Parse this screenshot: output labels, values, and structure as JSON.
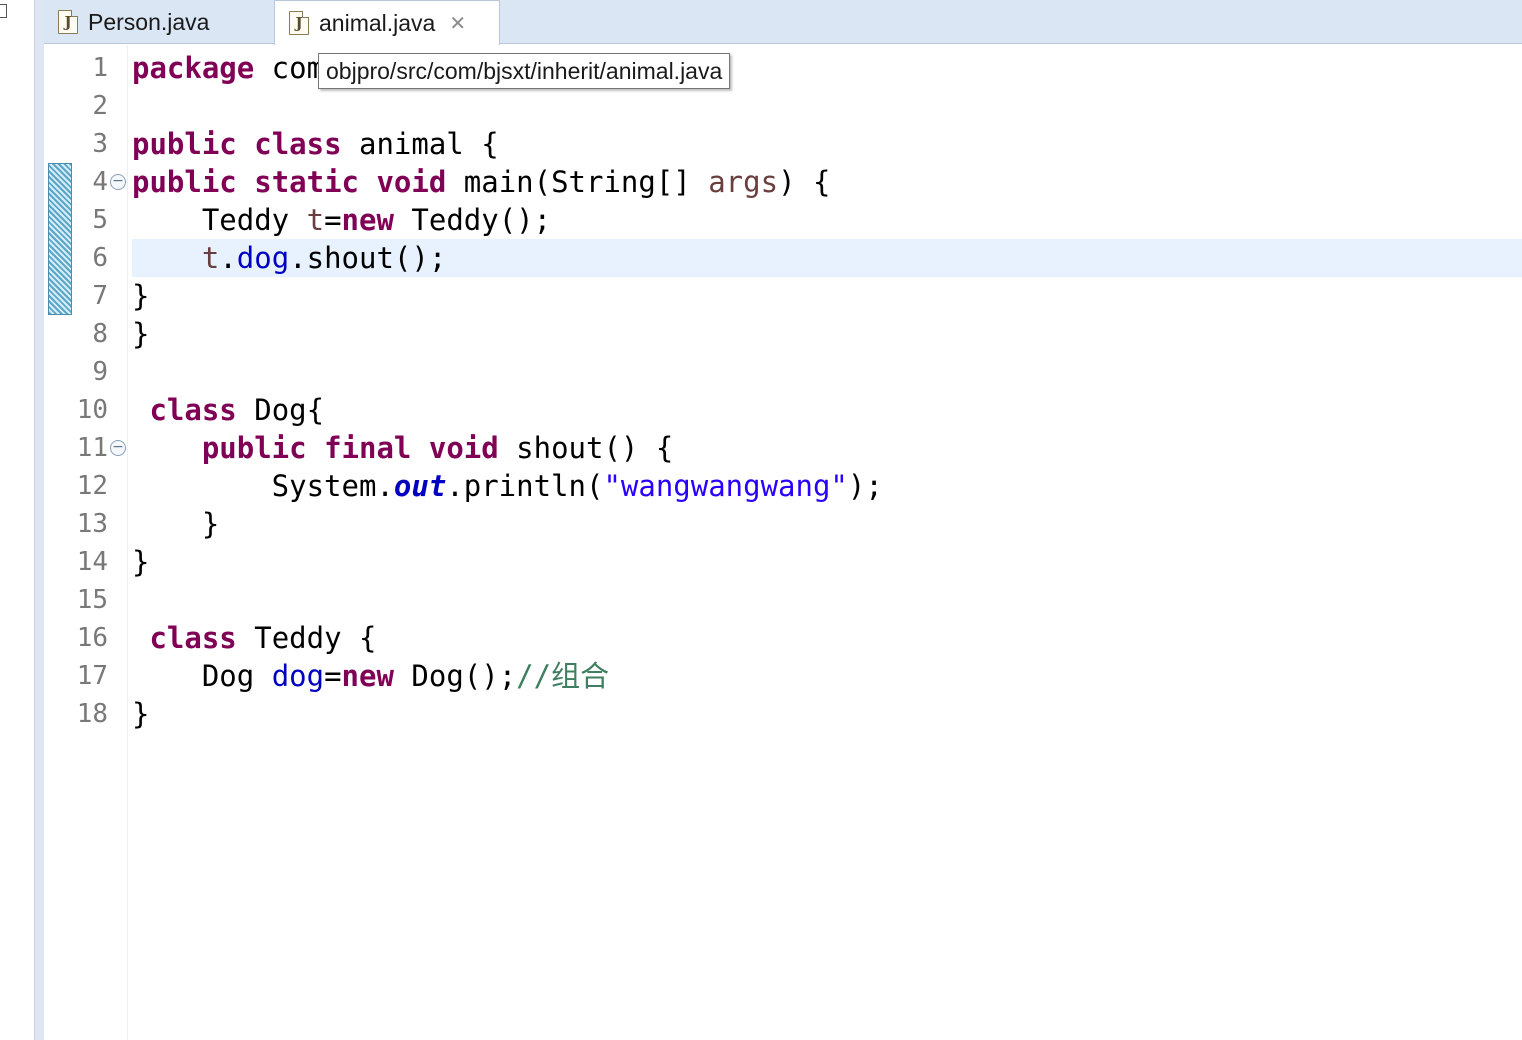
{
  "tabs": [
    {
      "label": "Person.java",
      "active": false,
      "icon": "java-file-icon"
    },
    {
      "label": "animal.java",
      "active": true,
      "icon": "java-file-icon",
      "close_glyph": "✕"
    }
  ],
  "tooltip": {
    "text": "objpro/src/com/bjsxt/inherit/animal.java"
  },
  "editor": {
    "current_line": 6,
    "diff_lines": [
      4,
      5,
      6,
      7
    ],
    "fold_lines": [
      4,
      11
    ],
    "fold_glyph": "−",
    "lines": [
      {
        "no": "1",
        "tokens": [
          {
            "t": "package",
            "c": "kw"
          },
          {
            "t": " com",
            "c": ""
          }
        ]
      },
      {
        "no": "2",
        "tokens": []
      },
      {
        "no": "3",
        "tokens": [
          {
            "t": "public",
            "c": "kw"
          },
          {
            "t": " ",
            "c": ""
          },
          {
            "t": "class",
            "c": "kw"
          },
          {
            "t": " animal {",
            "c": ""
          }
        ]
      },
      {
        "no": "4",
        "tokens": [
          {
            "t": "public",
            "c": "kw"
          },
          {
            "t": " ",
            "c": ""
          },
          {
            "t": "static",
            "c": "kw"
          },
          {
            "t": " ",
            "c": ""
          },
          {
            "t": "void",
            "c": "kw"
          },
          {
            "t": " main(String[] ",
            "c": ""
          },
          {
            "t": "args",
            "c": "param"
          },
          {
            "t": ") {",
            "c": ""
          }
        ]
      },
      {
        "no": "5",
        "tokens": [
          {
            "t": "    Teddy ",
            "c": ""
          },
          {
            "t": "t",
            "c": "param"
          },
          {
            "t": "=",
            "c": ""
          },
          {
            "t": "new",
            "c": "kw"
          },
          {
            "t": " Teddy();",
            "c": ""
          }
        ]
      },
      {
        "no": "6",
        "tokens": [
          {
            "t": "    ",
            "c": ""
          },
          {
            "t": "t",
            "c": "param"
          },
          {
            "t": ".",
            "c": ""
          },
          {
            "t": "dog",
            "c": "field"
          },
          {
            "t": ".shout();",
            "c": ""
          }
        ]
      },
      {
        "no": "7",
        "tokens": [
          {
            "t": "}",
            "c": ""
          }
        ]
      },
      {
        "no": "8",
        "tokens": [
          {
            "t": "}",
            "c": ""
          }
        ]
      },
      {
        "no": "9",
        "tokens": []
      },
      {
        "no": "10",
        "tokens": [
          {
            "t": " ",
            "c": ""
          },
          {
            "t": "class",
            "c": "kw"
          },
          {
            "t": " Dog{",
            "c": ""
          }
        ]
      },
      {
        "no": "11",
        "tokens": [
          {
            "t": "    ",
            "c": ""
          },
          {
            "t": "public",
            "c": "kw"
          },
          {
            "t": " ",
            "c": ""
          },
          {
            "t": "final",
            "c": "kw"
          },
          {
            "t": " ",
            "c": ""
          },
          {
            "t": "void",
            "c": "kw"
          },
          {
            "t": " shout() {",
            "c": ""
          }
        ]
      },
      {
        "no": "12",
        "tokens": [
          {
            "t": "        System.",
            "c": ""
          },
          {
            "t": "out",
            "c": "static-field"
          },
          {
            "t": ".println(",
            "c": ""
          },
          {
            "t": "\"wangwangwang\"",
            "c": "str"
          },
          {
            "t": ");",
            "c": ""
          }
        ]
      },
      {
        "no": "13",
        "tokens": [
          {
            "t": "    }",
            "c": ""
          }
        ]
      },
      {
        "no": "14",
        "tokens": [
          {
            "t": "}",
            "c": ""
          }
        ]
      },
      {
        "no": "15",
        "tokens": []
      },
      {
        "no": "16",
        "tokens": [
          {
            "t": " ",
            "c": ""
          },
          {
            "t": "class",
            "c": "kw"
          },
          {
            "t": " Teddy {",
            "c": ""
          }
        ]
      },
      {
        "no": "17",
        "tokens": [
          {
            "t": "    Dog ",
            "c": ""
          },
          {
            "t": "dog",
            "c": "field"
          },
          {
            "t": "=",
            "c": ""
          },
          {
            "t": "new",
            "c": "kw"
          },
          {
            "t": " Dog();",
            "c": ""
          },
          {
            "t": "//组合",
            "c": "comment"
          }
        ]
      },
      {
        "no": "18",
        "tokens": [
          {
            "t": "}",
            "c": ""
          }
        ]
      }
    ]
  }
}
